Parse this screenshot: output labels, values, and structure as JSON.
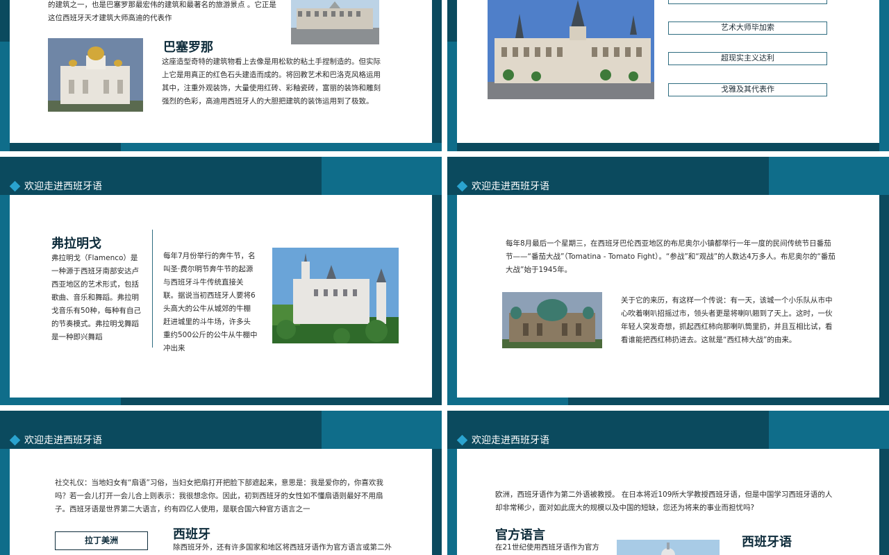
{
  "slides": {
    "s1": {
      "intro_text": "的建筑之一，也是巴塞罗那最宏伟的建筑和最著名的旅游景点 。它正是这位西班牙天才建筑大师高迪的代表作",
      "title": "巴塞罗那",
      "body": "这座造型奇特的建筑物看上去像是用松软的粘土手捏制造的。但实际上它是用真正的红色石头建造而成的。将回教艺术和巴洛克风格运用其中，注重外观装饰，大量使用红砖、彩釉瓷砖，富丽的装饰和雕刻强烈的色彩，高迪用西班牙人的大胆把建筑的装饰运用到了极致。"
    },
    "s2": {
      "buttons": [
        "艺术大师毕加索",
        "超现实主义达利",
        "戈雅及其代表作"
      ]
    },
    "s3": {
      "header": "欢迎走进西班牙语",
      "title": "弗拉明戈",
      "left_text": "弗拉明戈（Flamenco）是一种源于西班牙南部安达卢西亚地区的艺术形式，包括歌曲、音乐和舞蹈。弗拉明戈音乐有50种，每种有自己的节奏模式。弗拉明戈舞蹈是一种即兴舞蹈",
      "mid_text": "每年7月份举行的奔牛节，名叫圣·费尔明节奔牛节的起源与西班牙斗牛传统直接关联。据说当初西班牙人要将6头高大的公牛从城郊的牛棚赶进城里的斗牛场，许多头重约500公斤的公牛从牛棚中冲出来"
    },
    "s4": {
      "header": "欢迎走进西班牙语",
      "top_text": "每年8月最后一个星期三，在西班牙巴伦西亚地区的布尼奥尔小镇都举行一年一度的民间传统节日番茄节——“番茄大战”（Tomatina - Tomato Fight）。“参战”和“观战”的人数达4万多人。布尼奥尔的“番茄大战”始于1945年。",
      "side_text": "关于它的来历，有这样一个传说：有一天，该城一个小乐队从市中心吹着喇叭招摇过市，领头者更是将喇叭翘到了天上。这时，一伙年轻人突发奇想，抓起西红柿向那喇叭筒里扔，并且互相比试，看看谁能把西红柿扔进去。这就是“西红柿大战”的由来。"
    },
    "s5": {
      "header": "欢迎走进西班牙语",
      "top_text": "社交礼仪：当地妇女有“扇语”习俗，当妇女把扇打开把脸下部遮起来，意思是：我是爱你的，你喜欢我吗？若一会儿打开一会儿合上则表示：我很想念你。因此，初到西班牙的女性如不懂扇语则最好不用扇子。西班牙语是世界第二大语言，约有四亿人使用，是联合国六种官方语言之一",
      "button": "拉丁美洲",
      "title": "西班牙",
      "body": "除西班牙外，还有许多国家和地区将西班牙语作为官方语言或第二外"
    },
    "s6": {
      "header": "欢迎走进西班牙语",
      "top_text": "欧洲，西班牙语作为第二外语被教授。 在日本将近109所大学教授西班牙语，但是中国学习西班牙语的人却非常稀少，面对如此庞大的规模以及中国的短缺，您还为将来的事业而担忧吗?",
      "title_left": "官方语言",
      "left_text": "在21世纪使用西班牙语作为官方",
      "title_right": "西班牙语"
    }
  },
  "colors": {
    "dark": "#0b4a5e",
    "band": "#0f6d8a",
    "accent": "#2aa3cf"
  }
}
